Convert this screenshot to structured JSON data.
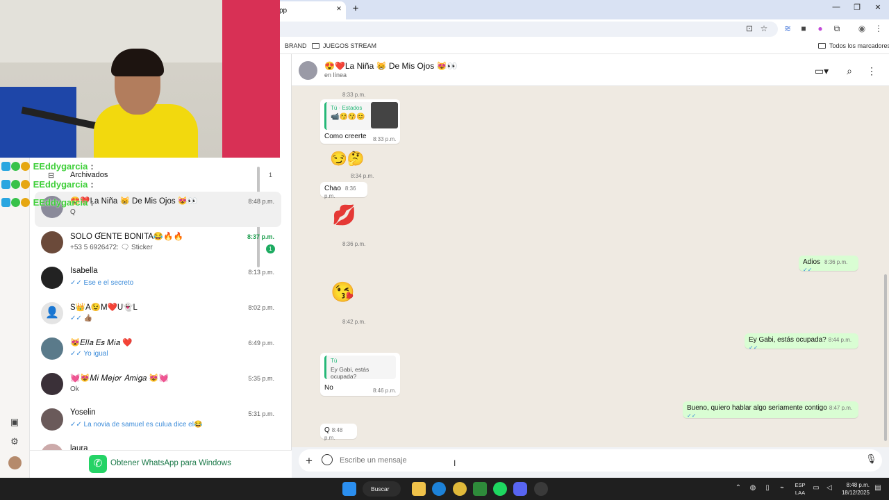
{
  "browser": {
    "tab_title": "pp",
    "tab_close": "×",
    "new_tab": "+",
    "window_controls": [
      "—",
      "❐",
      "✕"
    ],
    "bookmarks": [
      "BRAND",
      "JUEGOS STREAM"
    ],
    "all_bookmarks": "Todos los marcadores"
  },
  "stream_overlay": {
    "lines": [
      {
        "user": "EEddygarcia",
        "suffix": ":"
      },
      {
        "user": "EEddygarcia",
        "suffix": ":"
      },
      {
        "user": "EEddygarcia",
        "suffix": ":"
      }
    ]
  },
  "sidebar": {
    "archived_label": "Archivados",
    "archived_count": "1",
    "chats": [
      {
        "name": "😍❤️La Niña 😸 De Mis Ojos 😻👀",
        "preview": "Q",
        "time": "8:48 p.m.",
        "unread": "",
        "avatar_color": "#8a8a9a"
      },
      {
        "name": "SOLO ƓENTE BONITA😂🔥🔥",
        "preview": "+53 5 6926472: 🗨 Sticker",
        "time": "8:37 p.m.",
        "unread": "1",
        "avatar_color": "#6b4a3a"
      },
      {
        "name": "Isabella",
        "preview": "✓✓ Ese e el secreto",
        "time": "8:13 p.m.",
        "unread": "",
        "avatar_color": "#222222"
      },
      {
        "name": "S👑A😉M❤️U👻L",
        "preview": "✓✓ 👍🏽",
        "time": "8:02 p.m.",
        "unread": "",
        "avatar_color": "#e4e4e4"
      },
      {
        "name": "😻𝐸𝑙𝑙𝑎 𝐸𝑠 𝑀𝑖𝑎 ❤️",
        "preview": "✓✓ Yo igual",
        "time": "6:49 p.m.",
        "unread": "",
        "avatar_color": "#5a7a8a"
      },
      {
        "name": "💓😻𝑀𝑖 𝑀𝑒𝑗𝑜𝑟 𝐴𝑚𝑖𝑔𝑎 😻💓",
        "preview": "Ok",
        "time": "5:35 p.m.",
        "unread": "",
        "avatar_color": "#3a3038"
      },
      {
        "name": "Yoselin",
        "preview": "✓✓ La novia de samuel es culua dice el😂",
        "time": "5:31 p.m.",
        "unread": "",
        "avatar_color": "#6a5a5a"
      },
      {
        "name": "laura",
        "preview": "",
        "time": "",
        "unread": "",
        "avatar_color": "#caa"
      }
    ],
    "get_app_label": "Obtener WhatsApp para Windows"
  },
  "chat": {
    "contact_name": "😍❤️La Niña 😸 De Mis Ojos 😻👀",
    "status": "en línea",
    "messages": {
      "t1": "8:33 p.m.",
      "quote1_author": "Tú · Estados",
      "quote1_text": "📹😚😚😊",
      "m1_text": "Como creerte",
      "m1_time": "8:33 p.m.",
      "m2_emoji": "😏🤔",
      "m2_time": "8:34 p.m.",
      "m3_text": "Chao",
      "m3_time": "8:36 p.m.",
      "m4_emoji": "💋",
      "m4_time": "8:36 p.m.",
      "m5_text": "Adios",
      "m5_time": "8:36 p.m.",
      "m6_emoji": "😘",
      "m6_time": "8:42 p.m.",
      "m7_text": "Ey Gabi, estás ocupada?",
      "m7_time": "8:44 p.m.",
      "quote2_author": "Tú",
      "quote2_text": "Ey Gabi, estás ocupada?",
      "m8_text": "No",
      "m8_time": "8:46 p.m.",
      "m9_text": "Bueno, quiero hablar algo seriamente contigo",
      "m9_time": "8:47 p.m.",
      "m10_text": "Q",
      "m10_time": "8:48 p.m."
    },
    "read_ticks": "✓✓",
    "composer_placeholder": "Escribe un mensaje"
  },
  "taskbar": {
    "search_label": "Buscar",
    "lang": "ESP",
    "lang2": "LAA",
    "time": "8:48 p.m.",
    "date": "18/12/2025"
  },
  "colors": {
    "accent": "#25d366",
    "chat_bg": "#efeae2",
    "outgoing": "#d9fdd3"
  }
}
